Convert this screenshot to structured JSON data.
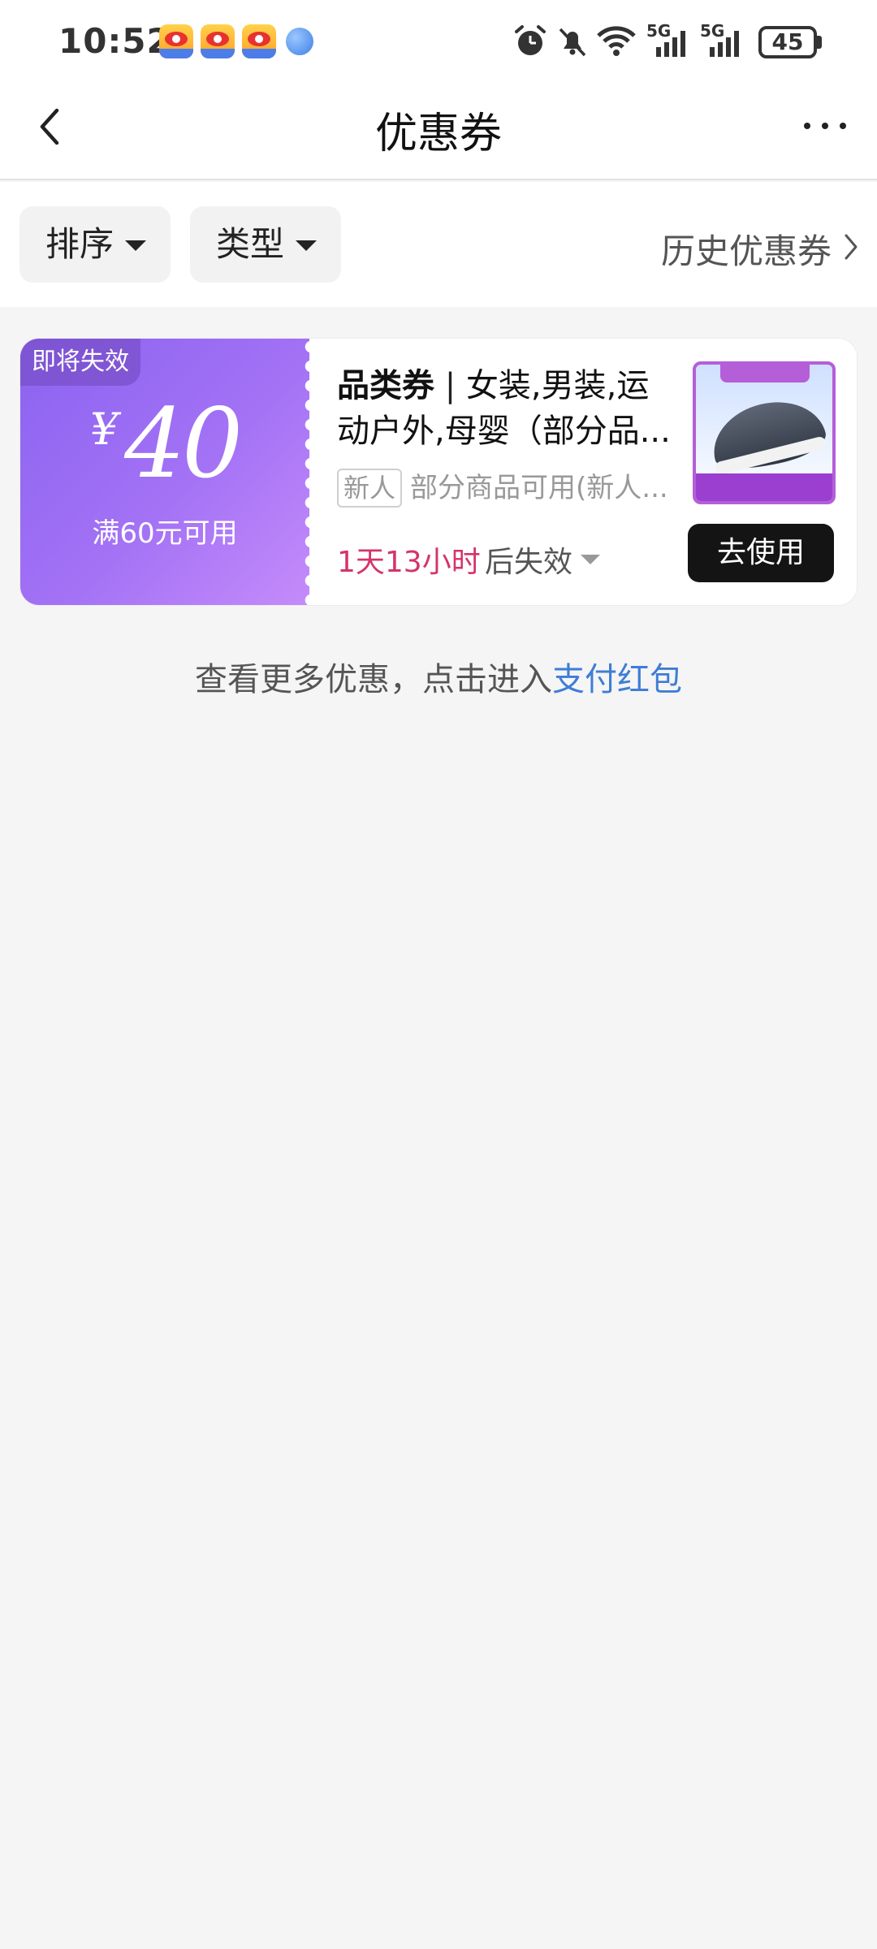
{
  "status_bar": {
    "time": "10:52",
    "apps": [
      "weibo-icon",
      "weibo-icon",
      "weibo-icon",
      "browser-icon"
    ],
    "network_1": "5G",
    "network_2": "5G",
    "battery": "45"
  },
  "header": {
    "title": "优惠券",
    "back_icon": "chevron-left-icon",
    "more_icon": "more-dots-icon"
  },
  "filters": {
    "sort_label": "排序",
    "type_label": "类型",
    "history_label": "历史优惠券"
  },
  "coupon": {
    "tag": "即将失效",
    "currency": "¥",
    "amount": "40",
    "condition": "满60元可用",
    "type": "品类券",
    "separator": "|",
    "title": "女装,男装,运动户外,母婴（部分品...",
    "badge": "新人",
    "description": "部分商品可用(新人...",
    "timer": "1天13小时",
    "expire_suffix": "后失效",
    "use_label": "去使用",
    "colors": {
      "left_start": "#8b63f0",
      "left_end": "#c58bfa",
      "timer": "#d5336c",
      "button": "#141414"
    }
  },
  "footer": {
    "text": "查看更多优惠，点击进入",
    "link": "支付红包",
    "link_color": "#3f7dd6"
  }
}
